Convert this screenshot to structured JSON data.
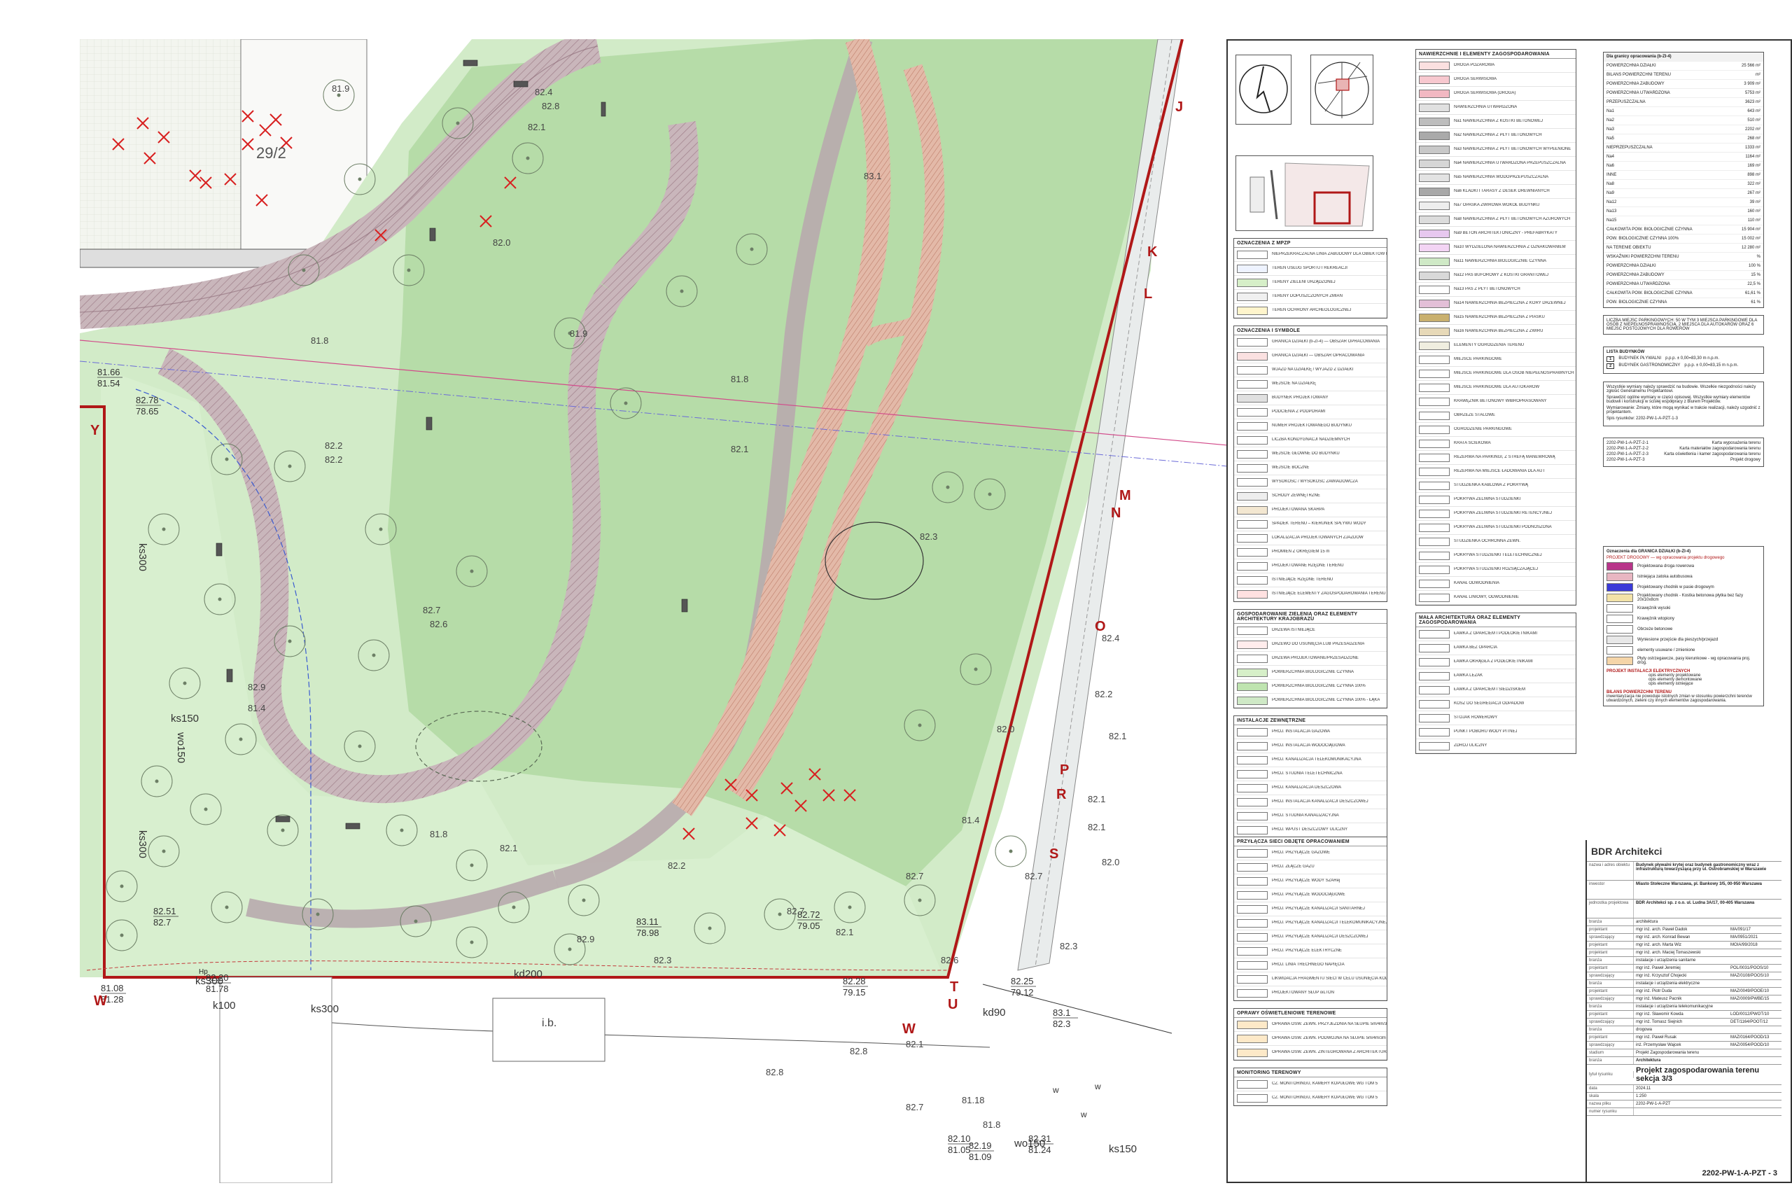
{
  "map": {
    "parcel_label": "29/2",
    "road_labels": [
      "ks300",
      "ks300",
      "ks150",
      "wo150",
      "k100",
      "ks300",
      "ks300",
      "kd200",
      "kd90",
      "wo150",
      "ks150"
    ],
    "section_letters": [
      "J",
      "K",
      "L",
      "M",
      "N",
      "O",
      "P",
      "R",
      "S",
      "T",
      "U",
      "W",
      "Y"
    ],
    "ib_label": "i.b.",
    "hp_label": "Hp",
    "w_letters": [
      "w",
      "w",
      "w"
    ],
    "elevations_pairs": [
      {
        "a": "81.66",
        "b": "81.54"
      },
      {
        "a": "82.78",
        "b": "78.65"
      },
      {
        "a": "82.51",
        "b": "82.7"
      },
      {
        "a": "83.11",
        "b": "78.98"
      },
      {
        "a": "82.72",
        "b": "79.05"
      },
      {
        "a": "82.20",
        "b": "81.78"
      },
      {
        "a": "81.08",
        "b": "81.28"
      },
      {
        "a": "82.25",
        "b": "79.12"
      },
      {
        "a": "82.10",
        "b": "81.05"
      },
      {
        "a": "82.19",
        "b": "81.09"
      },
      {
        "a": "82.31",
        "b": "81.24"
      },
      {
        "a": "82.28",
        "b": "79.15"
      },
      {
        "a": "83.1",
        "b": "82.3"
      }
    ],
    "elevations": [
      "81.9",
      "82.4",
      "82.8",
      "82.1",
      "82.0",
      "81.8",
      "81.9",
      "81.8",
      "82.2",
      "82.2",
      "82.1",
      "82.3",
      "82.7",
      "82.6",
      "82.9",
      "81.4",
      "81.8",
      "81.4",
      "82.1",
      "82.2",
      "82.1",
      "82.7",
      "82.9",
      "82.3",
      "82.7",
      "82.1",
      "81.18",
      "81.8",
      "82.3",
      "82.8",
      "82.4",
      "82.1",
      "82.1",
      "82.0",
      "82.1",
      "82.0",
      "82.7",
      "82.6",
      "82.8",
      "82.7",
      "83.1",
      "82.2"
    ],
    "red_frame_color": "#b01818",
    "green_light": "#cfe9c6",
    "green_mid": "#b9dfae",
    "path_color": "#c8b4b8",
    "deck_color": "#d9a99a"
  },
  "legend_col1": {
    "head_a": "OZNACZENIA Z MPZP",
    "a": [
      "NIEPRZEKRACZALNA LINIA ZABUDOWY DLA OBIEKTÓW NADZIEMNYCH",
      "TEREN USŁUG SPORTU I REKREACJI",
      "TERENY ZIELENI URZĄDZONEJ",
      "TERENY DOPUSZCZONYCH ZMIAN",
      "TEREN OCHRONY ARCHEOLOGICZNEJ"
    ],
    "head_b": "OZNACZENIA I SYMBOLE",
    "b": [
      "GRANICA DZIAŁKI (b-ZI-4) — OBSZAR OPRACOWANIA",
      "GRANICA DZIAŁKI — OBSZAR OPRACOWANIA",
      "WJAZD NA DZIAŁKĘ / WYJAZD Z DZIAŁKI",
      "WEJŚCIE NA DZIAŁKĘ",
      "BUDYNEK PROJEKTOWANY",
      "PODCIENIA Z PODPORAMI",
      "NUMER PROJEKTOWANEGO BUDYNKU",
      "LICZBA KONDYGNACJI NADZIEMNYCH",
      "WEJŚCIE GŁÓWNE DO BUDYNKU",
      "WEJŚCIE BOCZNE",
      "WYSOKOŚĆ / WYSOKOŚĆ ZAWIADOWCZA",
      "SCHODY ZEWNĘTRZNE",
      "PROJEKTOWANA SKARPA",
      "SPADEK TERENU – KIERUNEK SPŁYWU WODY",
      "LOKALIZACJA PROJEKTOWANYCH ZJAZDÓW",
      "PROMIEŃ Z OKRĘGIEM 15 m",
      "PROJEKTOWANE RZĘDNE TERENU",
      "ISTNIEJĄCE RZĘDNE TERENU",
      "ISTNIEJĄCE ELEMENTY ZAGOSPODAROWANIA TERENU DO LIKWIDACJI"
    ],
    "head_c": "GOSPODAROWANIE ZIELENIĄ ORAZ ELEMENTY ARCHITEKTURY KRAJOBRAZU",
    "c": [
      "DRZEWA ISTNIEJĄCE",
      "DRZEWO DO USUNIĘCIA LUB PRZESADZENIA",
      "DRZEWA PROJEKTOWANE/PRZESADZONE",
      "POWIERZCHNIA BIOLOGICZNIE CZYNNA",
      "POWIERZCHNIA BIOLOGICZNIE CZYNNA 100%",
      "POWIERZCHNIA BIOLOGICZNIE CZYNNA 100% - ŁĄKA"
    ],
    "head_d": "INSTALACJE ZEWNĘTRZNE",
    "d": [
      "PROJ. INSTALACJA GAZOWA",
      "PROJ. INSTALACJA WODOCIĄGOWA",
      "PROJ. KANALIZACJA TELEKOMUNIKACYJNA",
      "PROJ. STUDNIA TELETECHNICZNA",
      "PROJ. KANALIZACJA DESZCZOWA",
      "PROJ. INSTALACJA KANALIZACJI DESZCZOWEJ",
      "PROJ. STUDNIA KANALIZACYJNA",
      "PROJ. WPUST DESZCZOWY ULICZNY",
      "PROJ. SEPARATOR",
      "PROJ. PRZEPOMPOWNIA KANALIZACYJNA",
      "PROJ. LINIA ZASILANIA NISKIEGO NAPIĘCIA",
      "PROJ. LINIE ZASILAJĄCE OŚWIETLENIA ZEWN."
    ],
    "head_e": "PRZYŁĄCZA SIECI OBJĘTE OPRACOWANIEM",
    "e": [
      "PROJ. PRZYŁĄCZE GAZOWE",
      "PROJ. ZŁĄCZE GAZU",
      "PROJ. PRZYŁĄCZE WODY SZARej",
      "PROJ. PRZYŁĄCZE WODOCIĄGOWE",
      "PROJ. PRZYŁĄCZE KANALIZACJI SANITARNEJ",
      "PROJ. PRZYŁĄCZE KANALIZACJI TELEKOMUNIKACYJNEJ",
      "PROJ. PRZYŁĄCZE KANALIZACJI DESZCZOWEJ",
      "PROJ. PRZYŁĄCZE ELEKTRYCZNE",
      "PROJ. LINIA TRECHNEGO NAPIĘCIA",
      "LIKWIDACJA FRAGMENTU SIECI W CELU USUNIĘCIA KOLIZJI",
      "PROJEKTOWANY SŁUP oiLTON"
    ],
    "head_f": "OPRAWY OŚWIETLENIOWE TERENOWE",
    "f": [
      "OPRAWA OŚW. ZEWN. PRZYJEZDNIA NA SŁUPIE 5m/4m/3m",
      "OPRAWA OŚW. ZEWN. PODWÓJNA NA SŁUPIE 5m/4m/3m",
      "OPRAWA OŚW. ZEWN. ZINTEGROWANA Z ARCHITEKTURĄ"
    ],
    "head_g": "MONITORING TERENOWY",
    "g": [
      "CZ. MONITORINGU, KAMERY KOPUŁOWE WG TOM 5",
      "CZ. MONITORINGU, KAMERY KOPUŁOWE WG TOM 5"
    ]
  },
  "legend_col2": {
    "head_a": "NAWIERZCHNIE I ELEMENTY ZAGOSPODAROWANIA",
    "a": [
      "DROGA POŻAROWA",
      "DROGA SERWISOWA",
      "DROGA SERWISOWA (DROGA)",
      "NAWIERZCHNIA UTWARDZONA",
      "Na1 NAWIERZCHNIA Z KOSTKI BETONOWEJ",
      "Na2 NAWIERZCHNIA Z PŁYT BETONOWYCH",
      "Na3 NAWIERZCHNIA Z PŁYT BETONOWYCH WYPEŁNIONE",
      "Na4 NAWIERZCHNIA UTWARDZONA PRZEPUSZCZALNA",
      "Na5 NAWIERZCHNIA WODOPRZEPUSZCZALNA",
      "Na6 KLADKI I TARASY Z DESEK DREWNIANYCH",
      "Na7 OPASKA ŻWIROWA WOKÓŁ BUDYNKU",
      "Na8 NAWIERZCHNIA Z PŁYT BETONOWYCH AŻUROWYCH",
      "Na9 BETON ARCHITEKTONICZNY - PREFABRYKATY",
      "Na10 WYDZIELONA NAWIERZCHNIA Z OZNAKOWANIEM",
      "Na11 NAWIERZCHNIA BIOLOGICZNIE CZYNNA",
      "Na12 PAS BUFOROWY Z KOSTKI GRANITOWEJ",
      "Na13 PAS Z PŁYT BETONOWYCH",
      "Na14 NAWIERZCHNIA BEZPIECZNA Z KORY DRZEWNEJ",
      "Na15 NAWIERZCHNIA BEZPIECZNA Z PIASKU",
      "Na16 NAWIERZCHNIA BEZPIECZNA Z ŻWIRU",
      "ELEMENTY OGRODZENIA TERENU",
      "MIEJSCE PARKINGOWE",
      "MIEJSCE PARKINGOWE DLA OSÓB NIEPEŁNOSPRAWNYCH",
      "MIEJSCE PARKINGOWE DLA AUTOKARÓW",
      "KRAWĘŻNIK BETONOWY WIBROPRASOWANY",
      "OBRZEŻE STALOWE",
      "OGRODZENIE PARKINGOWE",
      "KRATA ŚCIEKOWA",
      "REZERWA NA PARKINGI, Z STREFĄ MANEWROWĄ",
      "REZERWA NA MIEJSCE ŁADOWANIA DLA AUT",
      "STUDZIENKA KABLOWA Z POKRYWĄ",
      "POKRYWA ŻELIWNA STUDZIENKI",
      "POKRYWA ŻELIWNA STUDZIENKI RETENCYJNEJ",
      "POKRYWA ŻELIWNA STUDZIENKI PODNOSZONA",
      "STUDZIENKA OCHRONNA ZEWN.",
      "POKRYWA STUDZIENKI TELETECHNICZNEJ",
      "POKRYWA STUDZIENKI ROZSĄCZAJĄCEJ",
      "KANAŁ ODWODNIENIA",
      "KANAŁ LINIOWY, ODWODNIENIE"
    ],
    "head_b": "MAŁA ARCHITEKTURA ORAZ ELEMENTY ZAGOSPODAROWANIA",
    "b": [
      "ŁAWKA Z OPARCIEM I PODŁOKIETNIKAMI",
      "ŁAWKA BEZ OPARCIA",
      "ŁAWKA OKRĄGŁA Z PODŁOKIETNIKAMI",
      "ŁAWKA LEŻAK",
      "ŁAWKA Z OPARCIEM I SIEDZISKIEM",
      "KOSZ DO SEGREGACJI ODPADÓW",
      "STOJAK ROWEROWY",
      "PUNKT POBORU WODY PITNEJ",
      "ZDRÓJ ULICZNY"
    ]
  },
  "area_table": {
    "head": "Dla granicy opracowania (b-ZI-4)",
    "rows": [
      {
        "l": "POWIERZCHNIA DZIAŁKI",
        "v": "25 566 m²"
      },
      {
        "l": "BILANS POWIERZCHNI TERENU",
        "v": "m²"
      },
      {
        "l": "POWIERZCHNIA ZABUDOWY",
        "v": "3 909 m²"
      },
      {
        "l": "POWIERZCHNIA UTWARDZONA",
        "v": "5753 m²"
      },
      {
        "l": "PRZEPUSZCZALNA",
        "v": "3623 m²"
      },
      {
        "l": "Na1",
        "v": "643 m²"
      },
      {
        "l": "Na2",
        "v": "510 m²"
      },
      {
        "l": "Na3",
        "v": "2202 m²"
      },
      {
        "l": "Na5",
        "v": "268 m²"
      },
      {
        "l": "NIEPRZEPUSZCZALNA",
        "v": "1333 m²"
      },
      {
        "l": "Na4",
        "v": "1164 m²"
      },
      {
        "l": "Na6",
        "v": "169 m²"
      },
      {
        "l": "INNE",
        "v": "898 m²"
      },
      {
        "l": "Na8",
        "v": "322 m²"
      },
      {
        "l": "Na9",
        "v": "267 m²"
      },
      {
        "l": "Na12",
        "v": "39 m²"
      },
      {
        "l": "Na13",
        "v": "160 m²"
      },
      {
        "l": "Na15",
        "v": "110 m²"
      },
      {
        "l": "CAŁKOWITA POW. BIOLOGICZNIE CZYNNA",
        "v": "15 904 m²"
      },
      {
        "l": "POW. BIOLOGICZNIE CZYNNA 100%",
        "v": "15 002 m²"
      },
      {
        "l": "NA TERENIE OBIEKTU",
        "v": "12 280 m²"
      },
      {
        "l": "WSKAŹNIKI POWIERZCHNI TERENU",
        "v": "%"
      },
      {
        "l": "POWIERZCHNIA DZIAŁKI",
        "v": "100 %"
      },
      {
        "l": "POWIERZCHNIA ZABUDOWY",
        "v": "15 %"
      },
      {
        "l": "POWIERZCHNIA UTWARDZONA",
        "v": "22,5 %"
      },
      {
        "l": "CAŁKOWITA POW. BIOLOGICZNIE CZYNNA",
        "v": "61,61 %"
      },
      {
        "l": "POW. BIOLOGICZNIE CZYNNA",
        "v": "61 %"
      }
    ],
    "note": "LICZBA MIEJSC PARKINGOWYCH: 50 W TYM 3 MIEJSCA PARKINGOWE DLA OSÓB Z NIEPEŁNOSPRAWNOŚCIĄ, 2 MIEJSCA DLA AUTOKARÓW ORAZ 6 MIEJSC POSTOJOWYCH DLA ROWERÓW",
    "buildings_head": "LISTA BUDYNKÓW",
    "buildings": [
      {
        "n": "1",
        "t": "BUDYNEK PŁYWALNI",
        "v": "p.p.p. ± 0,00=83,30 m n.p.m."
      },
      {
        "n": "2",
        "t": "BUDYNEK GASTRONOMICZNY",
        "v": "p.p.p. ± 0,00=83,15 m n.p.m."
      }
    ],
    "notes": [
      "Wszystkie wymiary należy sprawdzić na budowie. Wszelkie niezgodności należy zgłosić Generalnemu Projektantowi.",
      "Sprawdzić ogólne wymiary w części opisowej. Wszystkie wymiary elementów budowli i konstrukcji w ścisłej współpracy z Biurem Projektów.",
      "Wymiarowanie: Zmiany, które mogą wynikać w trakcie realizacji, należy uzgodnić z projektantem.",
      "Spis rysunków: 2202-PW-1-A-PZT-1-3"
    ],
    "sheets": [
      {
        "n": "2202-PW-1-A-PZT-2-1",
        "t": "Karta wyposażenia terenu"
      },
      {
        "n": "2202-PW-1-A-PZT-2-2",
        "t": "Karta materiałów zagospodarowania terenu"
      },
      {
        "n": "2202-PW-1-A-PZT-2-3",
        "t": "Karta oświetlenia i kamer zagospodarowania terenu"
      },
      {
        "n": "2202-PW-1-A-PZT-3",
        "t": "Projekt drogowy"
      }
    ],
    "road_head": "Oznaczenia dla GRANICA DZIAŁKI (b-ZI-4)",
    "road_sub": "PROJEKT DROGOWY — wg opracowania projektu drogowego",
    "road_items": [
      {
        "c": "#b8358a",
        "t": "Projektowana droga rowerowa"
      },
      {
        "c": "#e8b6c2",
        "t": "Istniejąca zatoka autobusowa"
      },
      {
        "c": "#3a3ad8",
        "t": "Projektowany chodnik w pasie drogowym"
      },
      {
        "c": "#f2e2a8",
        "t": "Projektowany chodnik - Kostka betonowa płytka bez fazy 20x10x8cm"
      },
      {
        "c": "#ffffff",
        "t": "Krawężnik wysoki"
      },
      {
        "c": "#ffffff",
        "t": "Krawężnik wtopiony"
      },
      {
        "c": "#ffffff",
        "t": "Obrzeże betonowe"
      },
      {
        "c": "#e8e8e8",
        "t": "Wyniesione przejście dla pieszych/przejazd"
      },
      {
        "c": "#ffffff",
        "t": "elementy usuwane / zmienione"
      },
      {
        "c": "#f5d5a8",
        "t": "Płyty ostrzegawcze, pasy kierunkowe - wg opracowania proj. drog."
      }
    ],
    "elec_head": "PROJEKT INSTALACJI ELEKTRYCZNYCH",
    "elec_items": [
      "opis elementy projektowane",
      "opis elementy demontowane",
      "opis elementy istniejące"
    ],
    "bilans_head": "BILANS POWIERZCHNI TERENU",
    "bilans_text": "inwentaryzacja nie powoduje istotnych zmian w stosunku powierzchni terenów utwardzonych, zieleni czy innych elementów zagospodarowania."
  },
  "title_block": {
    "firm": "BDR Architekci",
    "rows": [
      {
        "l": "nazwa i adres obiektu",
        "v": "Budynek pływalni krytej oraz budynek gastronomiczny wraz z infrastrukturą towarzyszącą przy ul. Ostrobramskiej w Warszawie"
      },
      {
        "l": "inwestor",
        "v": "Miasto Stołeczne Warszawa, pl. Bankowy 3/5, 00-950 Warszawa"
      },
      {
        "l": "jednostka projektowa",
        "v": "BDR Architekci sp. z o.o. ul. Ludna 3A/17, 00-405 Warszawa"
      }
    ],
    "team": [
      {
        "r": "branża",
        "n": "architektura",
        "u": ""
      },
      {
        "r": "projektant",
        "n": "mgr inż. arch. Paweł Dadok",
        "u": "MA/091/17"
      },
      {
        "r": "sprawdzający",
        "n": "mgr inż. arch. Konrad Bewan",
        "u": "MA/0951/2021"
      },
      {
        "r": "projektant",
        "n": "mgr inż. arch. Marta Wiz",
        "u": "MOIA/99/2018"
      },
      {
        "r": "projektant",
        "n": "mgr inż. arch. Maciej Tomaszewski",
        "u": ""
      },
      {
        "r": "branża",
        "n": "instalacje i urządzenia sanitarne",
        "u": ""
      },
      {
        "r": "projektant",
        "n": "mgr inż. Paweł Jeremiej",
        "u": "POL/0031/POOS/10"
      },
      {
        "r": "sprawdzający",
        "n": "mgr inż. Krzysztof Chojecki",
        "u": "MAZ/0108/POOS/10"
      },
      {
        "r": "branża",
        "n": "instalacje i urządzenia elektryczne",
        "u": ""
      },
      {
        "r": "projektant",
        "n": "mgr inż. Piotr Duda",
        "u": "MAZ/0049/POOE/10"
      },
      {
        "r": "sprawdzający",
        "n": "mgr inż. Mateusz Pacnik",
        "u": "MAZ/0009/PWBE/15"
      },
      {
        "r": "branża",
        "n": "instalacje i urządzenia telekomunikacyjne",
        "u": ""
      },
      {
        "r": "projektant",
        "n": "mgr inż. Sławomir Kowda",
        "u": "LOD/0012/PWOT/10"
      },
      {
        "r": "sprawdzający",
        "n": "mgr inż. Tomasz Siejnich",
        "u": "DET/1164/POOT/12"
      },
      {
        "r": "branża",
        "n": "drogowa",
        "u": ""
      },
      {
        "r": "projektant",
        "n": "mgr inż. Paweł Rusak",
        "u": "MAZ/0164/POOD/13"
      },
      {
        "r": "sprawdzający",
        "n": "inż. Przemysław Wajcek",
        "u": "MAZ/0054/POOD/10"
      }
    ],
    "stadium_l": "stadium",
    "stadium": "Projekt Zagospodarowania terenu",
    "branza_l": "branża",
    "branza": "Architektura",
    "tytul_l": "tytuł rysunku",
    "tytul": "Projekt zagospodarowania terenu sekcja 3/3",
    "data_l": "data",
    "data": "2024.11",
    "skala_l": "skala",
    "skala": "1:250",
    "nazwa_l": "nazwa pliku",
    "nazwa": "2202-PW-1-A-PZT",
    "nr_l": "numer rysunku",
    "nr": "2202-PW-1-A-PZT - 3"
  }
}
